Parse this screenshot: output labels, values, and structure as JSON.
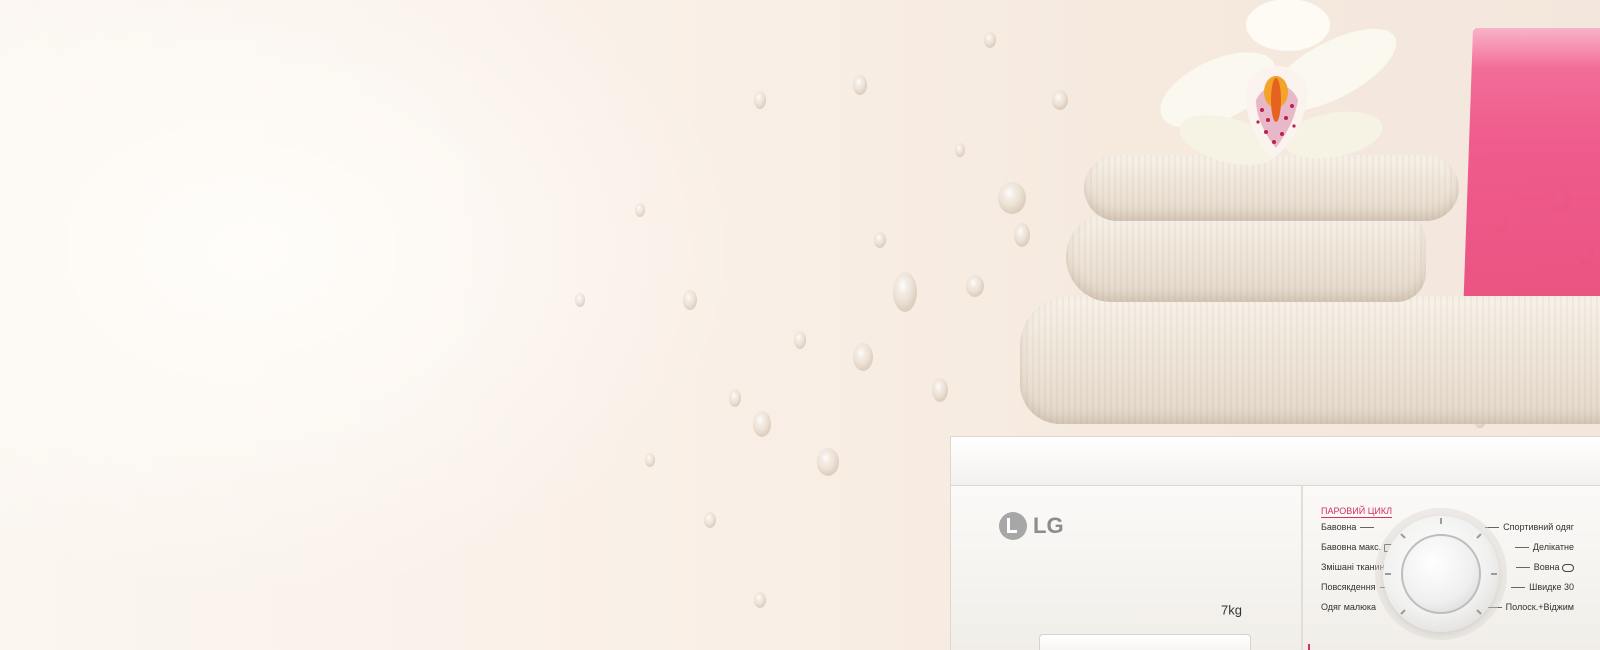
{
  "washer": {
    "brand": "LG",
    "capacity": "7kg",
    "steam_label": "ПАРОВИЙ ЦИКЛ",
    "programs_left": [
      "Бавовна",
      "Бавовна макс.",
      "Змішані тканини",
      "Повсякдення",
      "Одяг малюка"
    ],
    "programs_right": [
      "Спортивний одяг",
      "Делікатне",
      "Вовна",
      "Швидке 30",
      "Полоск.+Віджим"
    ]
  },
  "colors": {
    "background": "#f8efe6",
    "towel": "#efe6da",
    "cup": "#ee4f85",
    "accent_red": "#d3325f",
    "logo_gray": "#8c8c8c"
  },
  "icons": [
    "orchid-flower",
    "water-drops",
    "lg-logo"
  ]
}
